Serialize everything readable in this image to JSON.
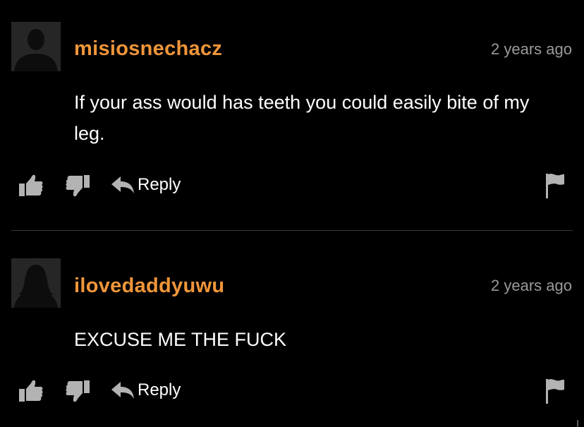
{
  "comments": [
    {
      "username": "misiosnechacz",
      "timestamp": "2 years ago",
      "text": "If your ass would has teeth you could easily bite of my leg.",
      "reply_label": "Reply"
    },
    {
      "username": "ilovedaddyuwu",
      "timestamp": "2 years ago",
      "text": "EXCUSE ME THE FUCK",
      "reply_label": "Reply"
    }
  ],
  "colors": {
    "background": "#000000",
    "username": "#f0963a",
    "timestamp": "#9a9a9a",
    "text": "#ffffff",
    "icon": "#b3b3b3",
    "avatar_bg": "#262626"
  },
  "icons": [
    "avatar-placeholder-icon",
    "thumbs-up-icon",
    "thumbs-down-icon",
    "reply-arrow-icon",
    "flag-icon"
  ]
}
